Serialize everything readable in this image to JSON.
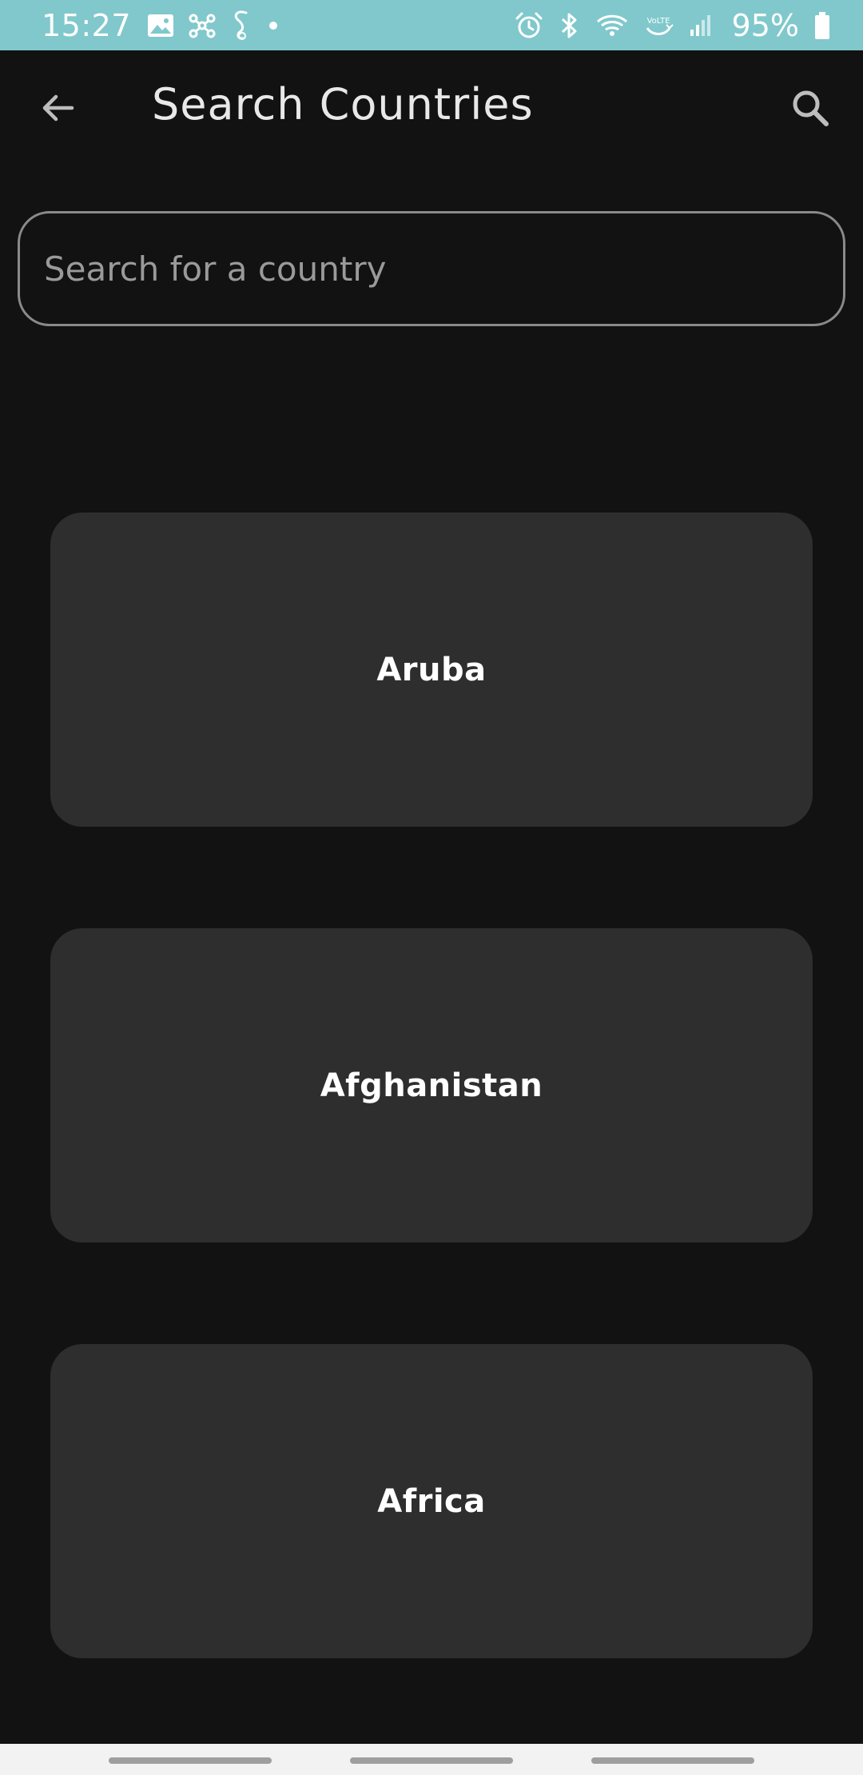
{
  "status_bar": {
    "time": "15:27",
    "battery": "95%",
    "left_icons": [
      "gallery-icon",
      "network-share-icon",
      "s-health-icon",
      "notification-dot-icon"
    ],
    "right_icons": [
      "alarm-icon",
      "bluetooth-icon",
      "wifi-icon",
      "volte-icon",
      "signal-icon",
      "battery-icon"
    ],
    "volte_label": "VoLTE",
    "bg_color": "#80c8cc"
  },
  "app_bar": {
    "title": "Search Countries",
    "back_icon": "arrow-back-icon",
    "search_icon": "search-icon"
  },
  "search": {
    "placeholder": "Search for a country",
    "value": ""
  },
  "countries": [
    {
      "name": "Aruba"
    },
    {
      "name": "Afghanistan"
    },
    {
      "name": "Africa"
    }
  ],
  "colors": {
    "background": "#121212",
    "card": "#2e2e2e",
    "text_primary": "#ffffff",
    "text_secondary": "#9a9a9a"
  }
}
